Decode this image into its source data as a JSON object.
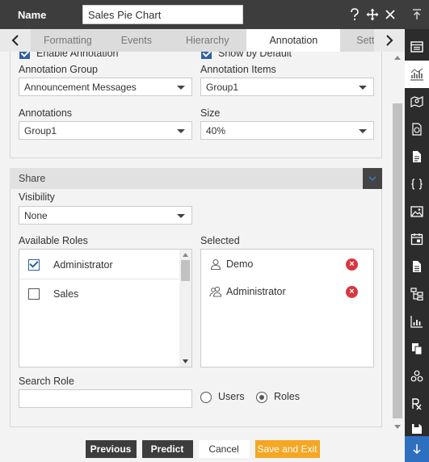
{
  "header": {
    "name_label": "Name",
    "name_value": "Sales Pie Chart"
  },
  "tabs": {
    "items": [
      "Formatting",
      "Events",
      "Hierarchy",
      "Annotation",
      "Settings"
    ],
    "active": "Annotation"
  },
  "annotation": {
    "enable_label": "Enable Annotation",
    "show_default_label": "Show by Default",
    "group_label": "Annotation Group",
    "group_value": "Announcement Messages",
    "items_label": "Annotation Items",
    "items_value": "Group1",
    "annotations_label": "Annotations",
    "annotations_value": "Group1",
    "size_label": "Size",
    "size_value": "40%"
  },
  "share": {
    "title": "Share",
    "visibility_label": "Visibility",
    "visibility_value": "None",
    "available_roles_label": "Available Roles",
    "available_roles": [
      {
        "label": "Administrator",
        "checked": true
      },
      {
        "label": "Sales",
        "checked": false
      }
    ],
    "selected_label": "Selected",
    "selected": [
      {
        "label": "Demo",
        "icon": "user-icon"
      },
      {
        "label": "Administrator",
        "icon": "users-icon"
      }
    ],
    "search_role_label": "Search Role",
    "search_role_value": "",
    "radio_users": "Users",
    "radio_roles": "Roles",
    "radio_selected": "Roles"
  },
  "footer": {
    "previous": "Previous",
    "predict": "Predict",
    "cancel": "Cancel",
    "save_exit": "Save and Exit"
  },
  "colors": {
    "dark": "#3d3d3d",
    "accent_blue": "#2f5fa8",
    "orange": "#f5a623",
    "remove_red": "#d9363e"
  }
}
